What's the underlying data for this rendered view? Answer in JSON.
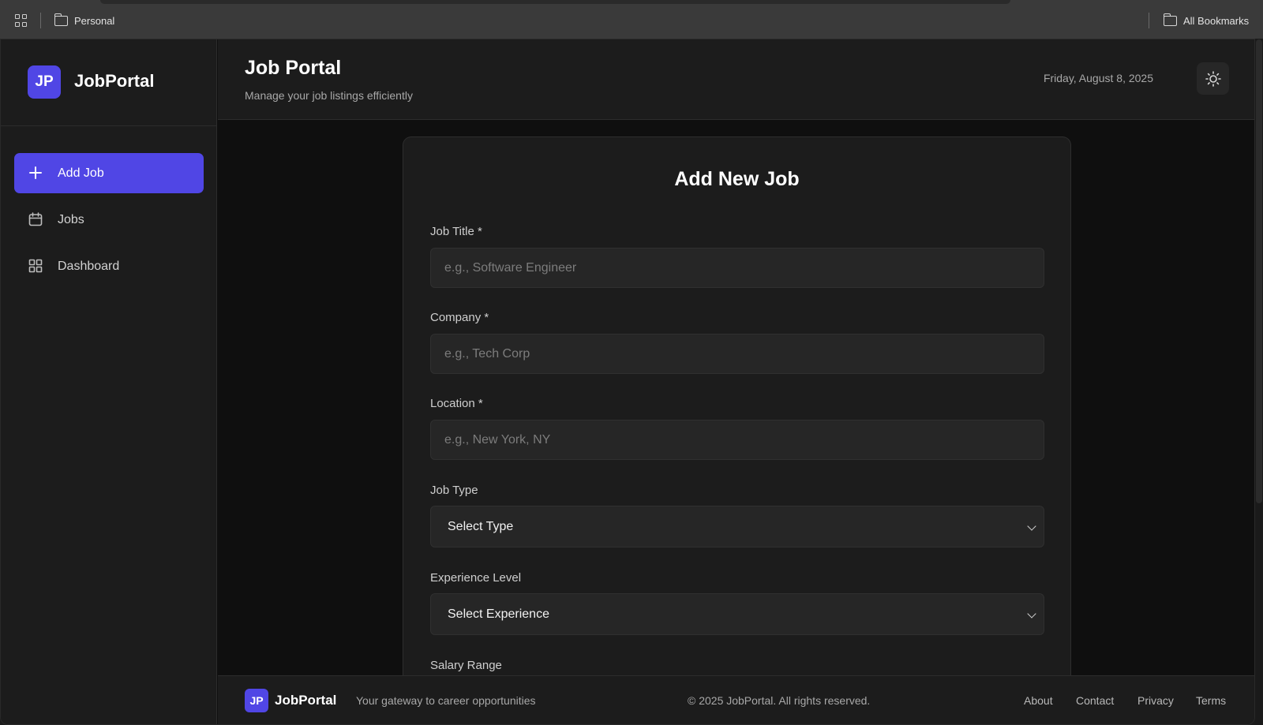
{
  "browser": {
    "bookmark_personal": "Personal",
    "bookmark_all": "All Bookmarks"
  },
  "sidebar": {
    "logo_initials": "JP",
    "brand": "JobPortal",
    "items": [
      {
        "label": "Add Job",
        "icon": "plus-icon",
        "active": true
      },
      {
        "label": "Jobs",
        "icon": "calendar-icon",
        "active": false
      },
      {
        "label": "Dashboard",
        "icon": "grid-icon",
        "active": false
      }
    ]
  },
  "header": {
    "title": "Job Portal",
    "subtitle": "Manage your job listings efficiently",
    "date": "Friday, August 8, 2025",
    "theme_icon": "sun-icon"
  },
  "form": {
    "title": "Add New Job",
    "job_title": {
      "label": "Job Title *",
      "placeholder": "e.g., Software Engineer",
      "value": ""
    },
    "company": {
      "label": "Company *",
      "placeholder": "e.g., Tech Corp",
      "value": ""
    },
    "location": {
      "label": "Location *",
      "placeholder": "e.g., New York, NY",
      "value": ""
    },
    "job_type": {
      "label": "Job Type",
      "selected": "Select Type"
    },
    "experience": {
      "label": "Experience Level",
      "selected": "Select Experience"
    },
    "salary": {
      "label": "Salary Range"
    }
  },
  "footer": {
    "logo_initials": "JP",
    "brand": "JobPortal",
    "tagline": "Your gateway to career opportunities",
    "copyright": "© 2025 JobPortal. All rights reserved.",
    "links": [
      "About",
      "Contact",
      "Privacy",
      "Terms"
    ]
  },
  "colors": {
    "accent": "#5046e5",
    "background": "#0f0f0f",
    "surface": "#1c1c1c",
    "input": "#262626"
  }
}
